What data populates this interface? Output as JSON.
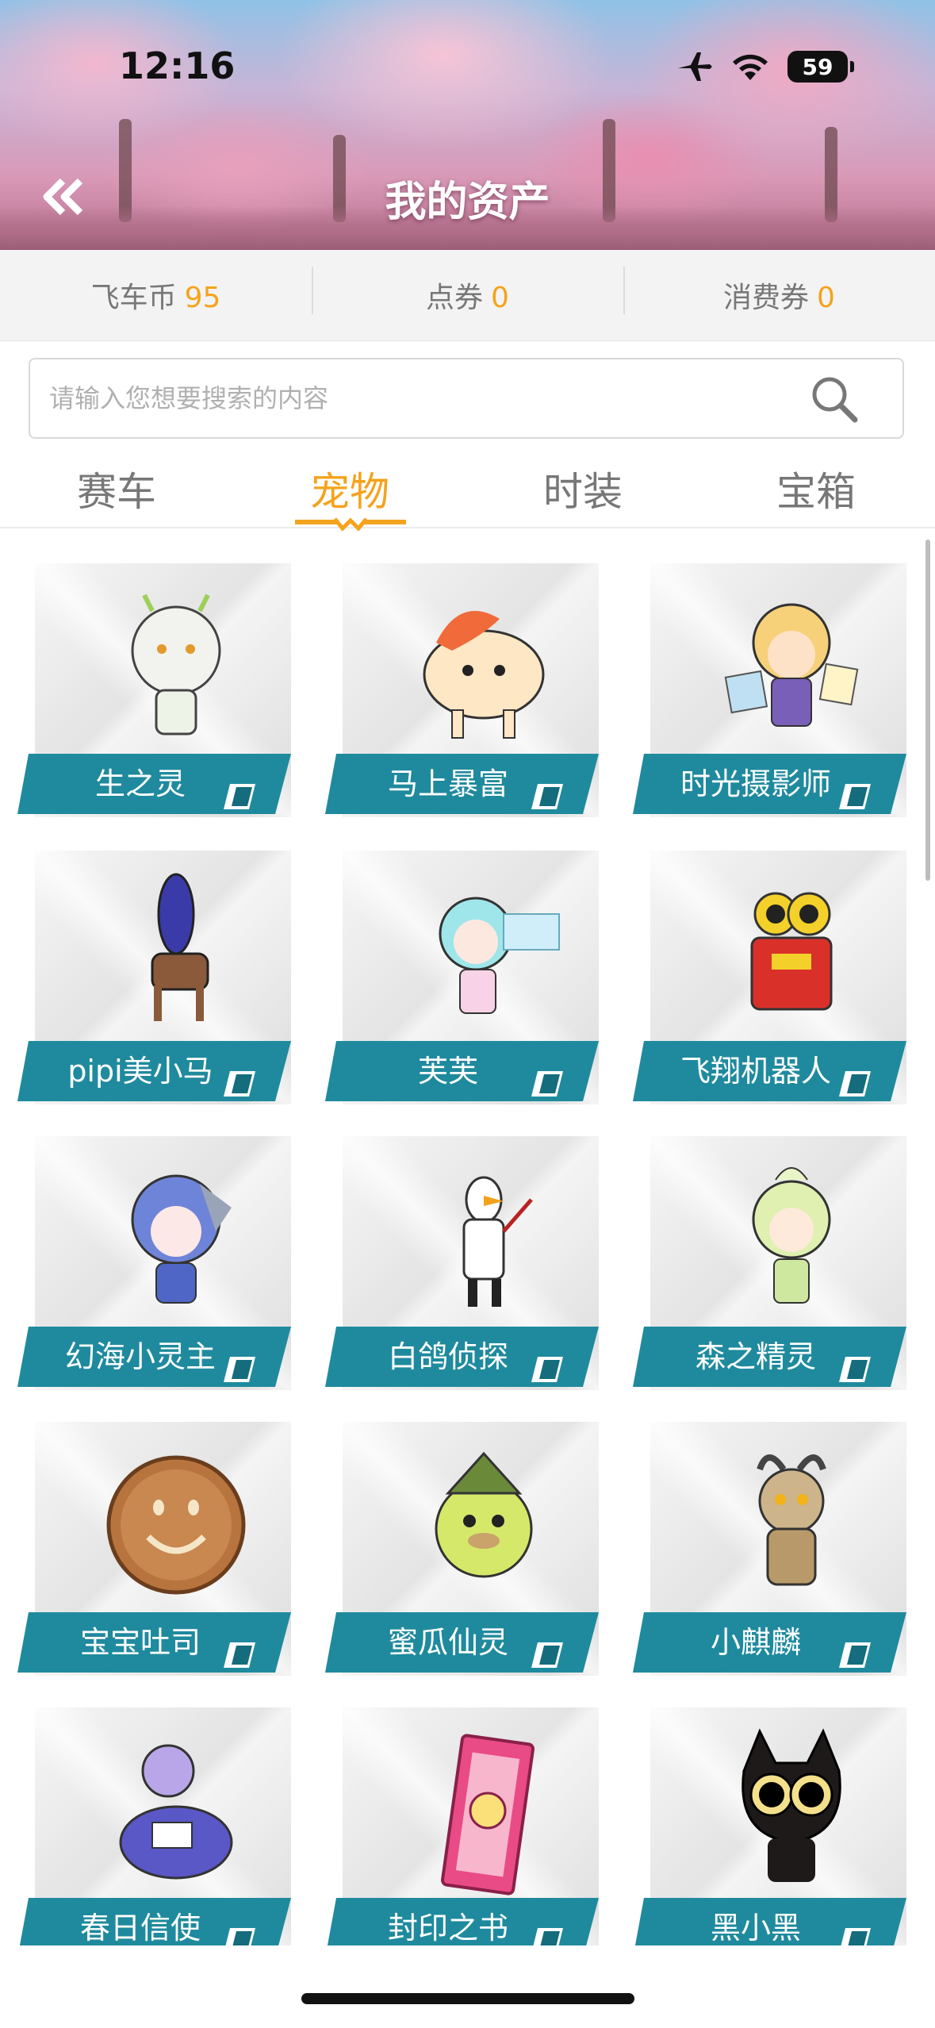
{
  "status_bar": {
    "time": "12:16",
    "battery": "59",
    "icons": [
      "airplane-icon",
      "wifi-icon",
      "battery-icon"
    ]
  },
  "header": {
    "title": "我的资产",
    "back_icon": "double-chevron-left-icon"
  },
  "currencies": [
    {
      "label": "飞车币",
      "value": "95"
    },
    {
      "label": "点券",
      "value": "0"
    },
    {
      "label": "消费券",
      "value": "0"
    }
  ],
  "search": {
    "placeholder": "请输入您想要搜索的内容",
    "icon": "search-icon"
  },
  "tabs": [
    {
      "label": "赛车",
      "active": false
    },
    {
      "label": "宠物",
      "active": true
    },
    {
      "label": "时装",
      "active": false
    },
    {
      "label": "宝箱",
      "active": false
    }
  ],
  "pets": [
    {
      "name": "生之灵"
    },
    {
      "name": "马上暴富"
    },
    {
      "name": "时光摄影师"
    },
    {
      "name": "pipi美小马"
    },
    {
      "name": "芙芙"
    },
    {
      "name": "飞翔机器人"
    },
    {
      "name": "幻海小灵主"
    },
    {
      "name": "白鸽侦探"
    },
    {
      "name": "森之精灵"
    },
    {
      "name": "宝宝吐司"
    },
    {
      "name": "蜜瓜仙灵"
    },
    {
      "name": "小麒麟"
    },
    {
      "name": "春日信使"
    },
    {
      "name": "封印之书"
    },
    {
      "name": "黑小黑"
    }
  ],
  "colors": {
    "accent": "#f4a31c",
    "ribbon": "#1f8a9e",
    "ribbon_dark": "#146c7d"
  }
}
